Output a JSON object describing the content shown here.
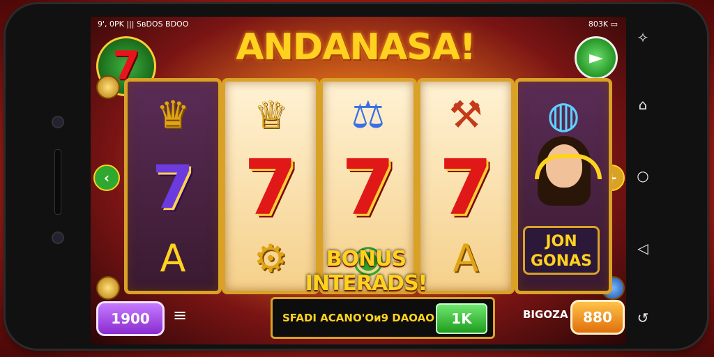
{
  "status": {
    "left": "9', 0PK  ||| SвDOS BDOO",
    "right": "803K"
  },
  "title": "ANDANASA!",
  "logo_symbol": "7",
  "reels": [
    {
      "top": "♛",
      "mid": "7",
      "bottom": "A"
    },
    {
      "top": "♕",
      "mid": "7",
      "bottom": "⚙"
    },
    {
      "top": "⚖",
      "mid": "7",
      "bottom": "◉"
    },
    {
      "top": "⚒",
      "mid": "7",
      "bottom": "A"
    },
    {
      "top": "◍",
      "mid": "",
      "bottom": ""
    }
  ],
  "bonus_text": "BONUS INTERADS!",
  "join_badge": "JON\nGONAS",
  "bottom": {
    "bet": "1900",
    "message": "SFADI ACANO'Oи9 DAOAO",
    "ok_label": "1K",
    "credits_label": "BIGOZA",
    "credits": "880"
  },
  "nav_buttons": [
    "✧",
    "⌂",
    "○",
    "◁",
    "↺"
  ],
  "colors": {
    "accent_gold": "#ffd21f",
    "seven_red": "#e01818",
    "frame_gold": "#d9a227"
  }
}
